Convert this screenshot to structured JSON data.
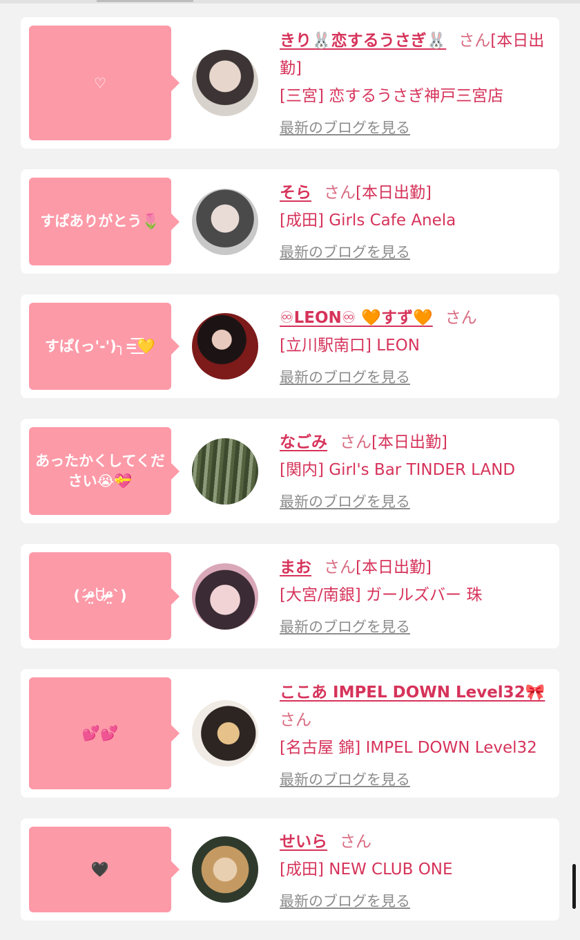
{
  "cards": [
    {
      "bubble": "♡",
      "name": "きり🐰恋するうさぎ🐰",
      "san": "さん",
      "status": "[本日出勤]",
      "shop": "[三宮] 恋するうさぎ神戸三宮店",
      "blog_link": "最新のブログを見る",
      "avatar_colors": [
        "#6a6a6a",
        "#d9c9c0"
      ]
    },
    {
      "bubble": "すぱありがとう🌷",
      "name": "そら",
      "san": "さん",
      "status": "[本日出勤]",
      "shop": "[成田] Girls Cafe Anela",
      "blog_link": "最新のブログを見る",
      "avatar_colors": [
        "#cfcfcf",
        "#5a5a5a"
      ]
    },
    {
      "bubble": "すぱ(っ'-')╮=͟͟͞͞💛",
      "name": "♾LEON♾ 🧡すず🧡",
      "san": "さん",
      "status": "",
      "shop": "[立川駅南口] LEON",
      "blog_link": "最新のブログを見る",
      "avatar_colors": [
        "#7a1414",
        "#1a1a1a"
      ]
    },
    {
      "bubble": "あったかくしてください😭💝",
      "name": "なごみ",
      "san": "さん",
      "status": "[本日出勤]",
      "shop": "[関内] Girl's Bar TINDER LAND",
      "blog_link": "最新のブログを見る",
      "avatar_colors": [
        "#4d5a3c",
        "#8a9a78"
      ]
    },
    {
      "bubble": "(ˊᵒ̴̶̷̤ꇴᵒ̴̶̷̤ˋ)",
      "name": "まお",
      "san": "さん",
      "status": "[本日出勤]",
      "shop": "[大宮/南銀] ガールズバー 珠",
      "blog_link": "最新のブログを見る",
      "avatar_colors": [
        "#3a2a3a",
        "#e8c0c8"
      ]
    },
    {
      "bubble": "💕💕",
      "name": "ここあ IMPEL DOWN Level32🎀",
      "san": "さん",
      "status": "",
      "shop": "[名古屋 錦] IMPEL DOWN Level32",
      "blog_link": "最新のブログを見る",
      "avatar_colors": [
        "#c7a060",
        "#2b2b2b"
      ]
    },
    {
      "bubble": "🖤",
      "name": "せいら",
      "san": "さん",
      "status": "",
      "shop": "[成田] NEW CLUB ONE",
      "blog_link": "最新のブログを見る",
      "avatar_colors": [
        "#b98a5a",
        "#2a3a2a"
      ]
    }
  ],
  "accent_color": "#fd9aa8",
  "link_color": "#d6335a"
}
